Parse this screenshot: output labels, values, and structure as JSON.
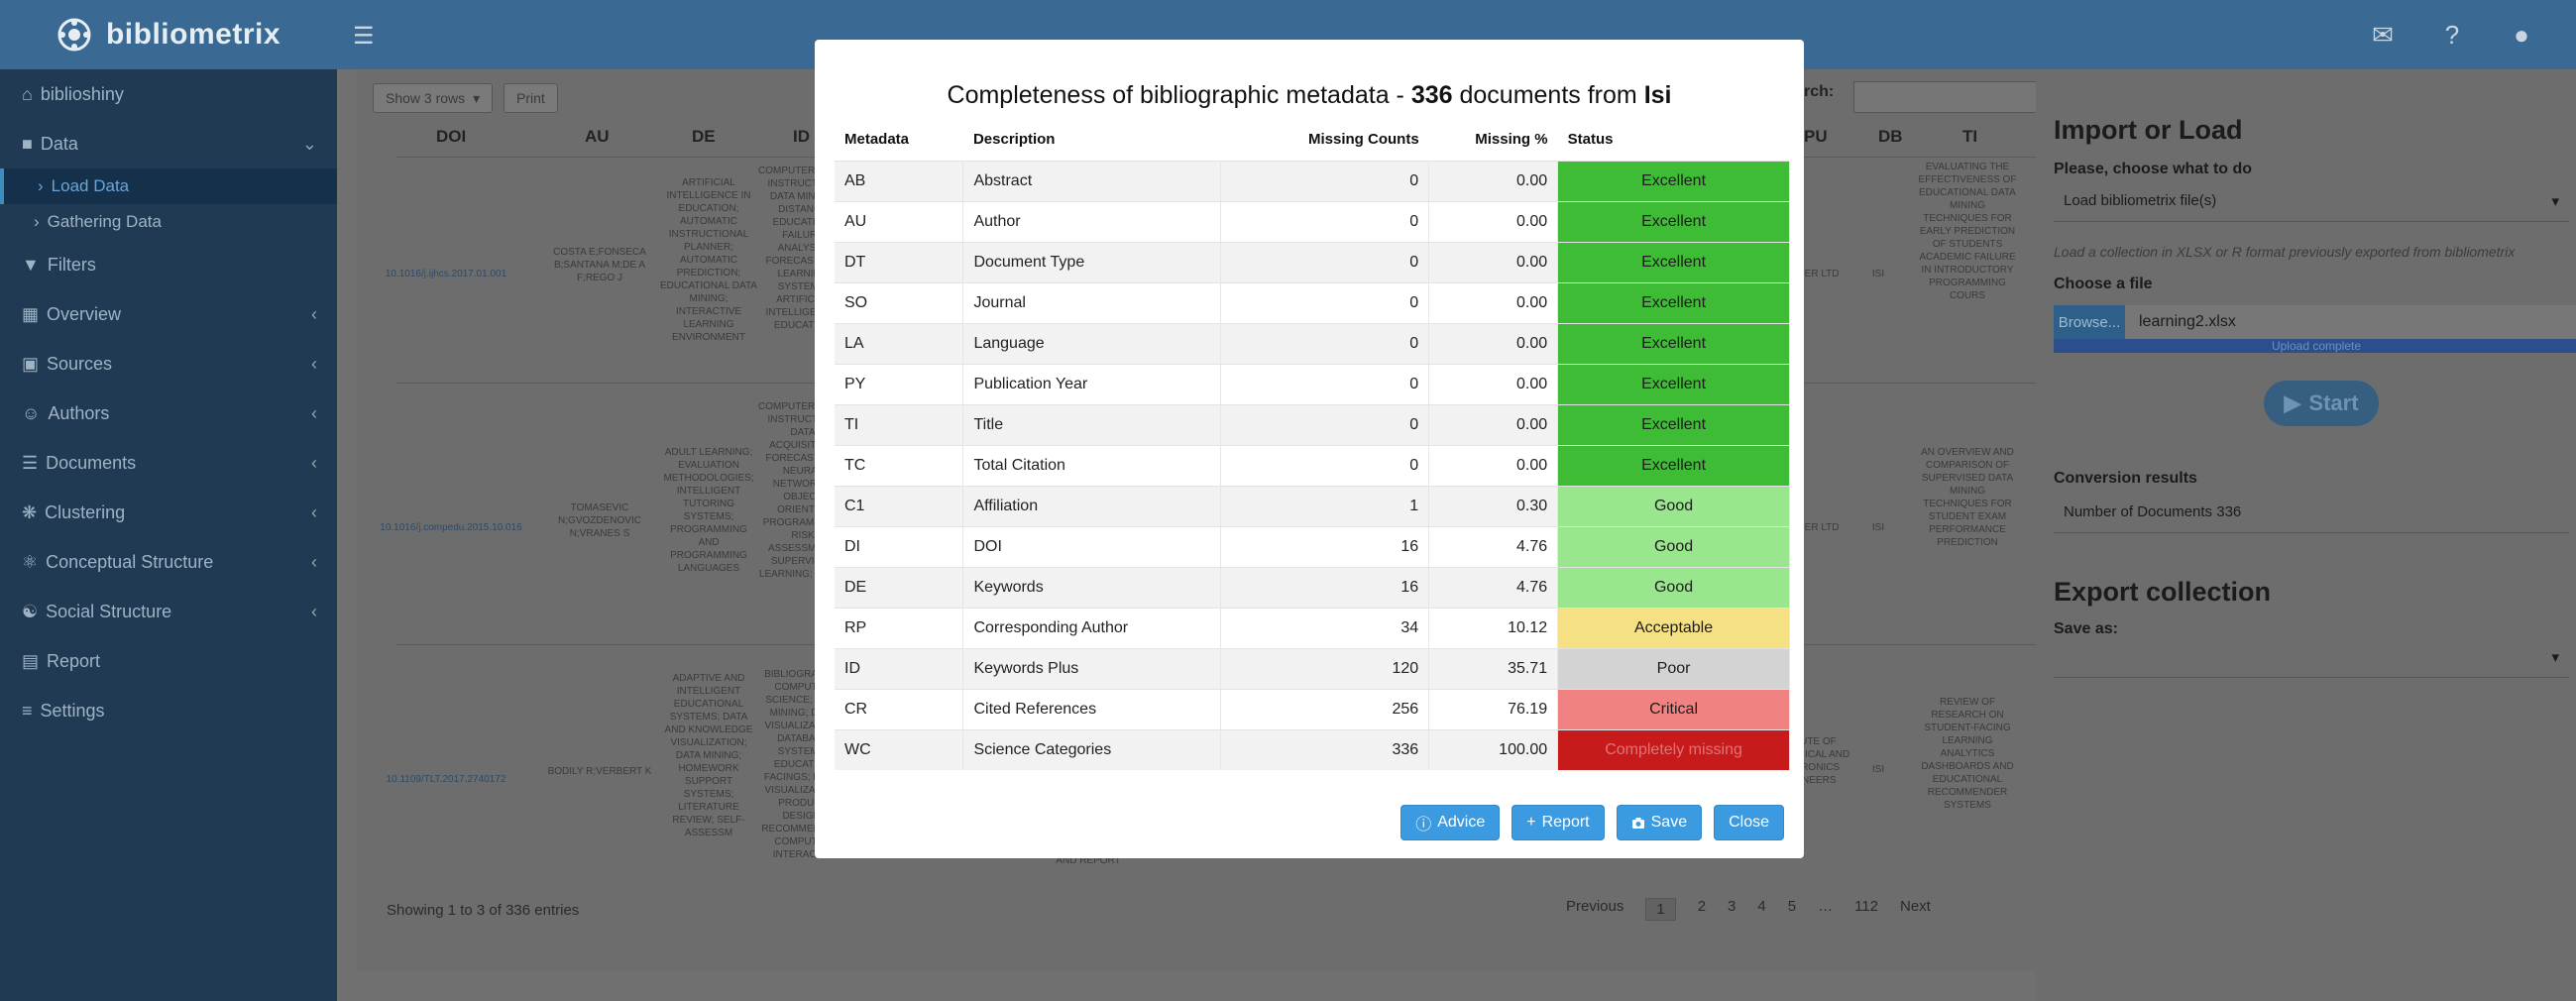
{
  "app": {
    "title": "bibliometrix"
  },
  "sidebar": {
    "items": [
      {
        "label": "biblioshiny",
        "icon": "home-icon"
      },
      {
        "label": "Data",
        "icon": "book-icon"
      },
      {
        "label": "Load Data",
        "icon": "chevron-right-icon"
      },
      {
        "label": "Gathering Data",
        "icon": "chevron-right-icon"
      },
      {
        "label": "Filters",
        "icon": "filter-icon"
      },
      {
        "label": "Overview",
        "icon": "grid-icon"
      },
      {
        "label": "Sources",
        "icon": "sources-icon"
      },
      {
        "label": "Authors",
        "icon": "user-icon"
      },
      {
        "label": "Documents",
        "icon": "documents-icon"
      },
      {
        "label": "Clustering",
        "icon": "clustering-icon"
      },
      {
        "label": "Conceptual Structure",
        "icon": "conceptual-icon"
      },
      {
        "label": "Social Structure",
        "icon": "social-icon"
      },
      {
        "label": "Report",
        "icon": "report-icon"
      },
      {
        "label": "Settings",
        "icon": "settings-icon"
      }
    ]
  },
  "background_table": {
    "show_rows": "Show 3 rows",
    "print": "Print",
    "search_label": "rch:",
    "headers": [
      "DOI",
      "AU",
      "DE",
      "ID",
      "PU",
      "DB",
      "TI"
    ],
    "rows": [
      {
        "doi": "10.1016/j.ijhcs.2017.01.001",
        "au": "COSTA E;FONSECA B;SANTANA M;DE A F;REGO J",
        "de": "ARTIFICIAL INTELLIGENCE IN EDUCATION; AUTOMATIC INSTRUCTIONAL PLANNER; AUTOMATIC PREDICTION; EDUCATIONAL DATA MINING; INTERACTIVE LEARNING ENVIRONMENT",
        "id": "COMPUTER AIDED INSTRUCTION; DATA MINING; DISTANCE EDUCATION; FAILURE ANALYSIS; FORECASTING; LEARNING SYSTEMS; ARTIFICIAL INTELLIGENCE; EDUCATION",
        "pu": "EVIER LTD",
        "db": "ISI",
        "ti": "EVALUATING THE EFFECTIVENESS OF EDUCATIONAL DATA MINING TECHNIQUES FOR EARLY PREDICTION OF STUDENTS ACADEMIC FAILURE IN INTRODUCTORY PROGRAMMING COURS"
      },
      {
        "doi": "10.1016/j.compedu.2015.10.016",
        "au": "TOMASEVIC N;GVOZDENOVIC N;VRANES S",
        "de": "ADULT LEARNING; EVALUATION METHODOLOGIES; INTELLIGENT TUTORING SYSTEMS; PROGRAMMING AND PROGRAMMING LANGUAGES",
        "id": "COMPUTER AIDED INSTRUCTION; DATA ACQUISITION; FORECASTING; NEURAL NETWORKS; OBJECT ORIENTED PROGRAMMING; RISK ASSESSMENT; SUPERVISED LEARNING; ADULT",
        "pu": "EVIER LTD",
        "db": "ISI",
        "ti": "AN OVERVIEW AND COMPARISON OF SUPERVISED DATA MINING TECHNIQUES FOR STUDENT EXAM PERFORMANCE PREDICTION"
      },
      {
        "doi": "10.1109/TLT.2017.2740172",
        "au": "BODILY R;VERBERT K",
        "de": "ADAPTIVE AND INTELLIGENT EDUCATIONAL SYSTEMS; DATA AND KNOWLEDGE VISUALIZATION; DATA MINING; HOMEWORK SUPPORT SYSTEMS; LITERATURE REVIEW; SELF-ASSESSM",
        "id": "BIBLIOGRAPHIC COMPUTER SCIENCE; DATA MINING; DATA VISUALIZATION; DATABASE SYSTEMS; EDUCATION FACINGS; FLOW VISUALIZATION; PRODUCT DESIGN; RECOMMENDER; COMPUTER INTERACTIO",
        "extra": "AND REPORT",
        "pu": "ITUTE OF ECTRICAL AND CTRONICS GINEERS",
        "db": "ISI",
        "ti": "REVIEW OF RESEARCH ON STUDENT-FACING LEARNING ANALYTICS DASHBOARDS AND EDUCATIONAL RECOMMENDER SYSTEMS"
      }
    ],
    "footer": "Showing 1 to 3 of 336 entries",
    "pager": [
      "Previous",
      "1",
      "2",
      "3",
      "4",
      "5",
      "…",
      "112",
      "Next"
    ]
  },
  "right_panel": {
    "import_title": "Import or Load",
    "choose_label": "Please, choose what to do",
    "choose_value": "Load bibliometrix file(s)",
    "note": "Load a collection in XLSX or R format previously exported from bibliometrix",
    "file_label": "Choose a file",
    "browse": "Browse...",
    "file_name": "learning2.xlsx",
    "upload_status": "Upload complete",
    "start": "Start",
    "conversion_label": "Conversion results",
    "doc_count": "Number of Documents  336",
    "export_title": "Export collection",
    "save_as_label": "Save as:"
  },
  "modal": {
    "title_prefix": "Completeness of bibliographic metadata - ",
    "title_count": "336",
    "title_mid": " documents from ",
    "title_source": "Isi",
    "columns": [
      "Metadata",
      "Description",
      "Missing Counts",
      "Missing %",
      "Status"
    ],
    "rows": [
      {
        "metadata": "AB",
        "description": "Abstract",
        "missing_counts": "0",
        "missing_pct": "0.00",
        "status": "Excellent"
      },
      {
        "metadata": "AU",
        "description": "Author",
        "missing_counts": "0",
        "missing_pct": "0.00",
        "status": "Excellent"
      },
      {
        "metadata": "DT",
        "description": "Document Type",
        "missing_counts": "0",
        "missing_pct": "0.00",
        "status": "Excellent"
      },
      {
        "metadata": "SO",
        "description": "Journal",
        "missing_counts": "0",
        "missing_pct": "0.00",
        "status": "Excellent"
      },
      {
        "metadata": "LA",
        "description": "Language",
        "missing_counts": "0",
        "missing_pct": "0.00",
        "status": "Excellent"
      },
      {
        "metadata": "PY",
        "description": "Publication Year",
        "missing_counts": "0",
        "missing_pct": "0.00",
        "status": "Excellent"
      },
      {
        "metadata": "TI",
        "description": "Title",
        "missing_counts": "0",
        "missing_pct": "0.00",
        "status": "Excellent"
      },
      {
        "metadata": "TC",
        "description": "Total Citation",
        "missing_counts": "0",
        "missing_pct": "0.00",
        "status": "Excellent"
      },
      {
        "metadata": "C1",
        "description": "Affiliation",
        "missing_counts": "1",
        "missing_pct": "0.30",
        "status": "Good"
      },
      {
        "metadata": "DI",
        "description": "DOI",
        "missing_counts": "16",
        "missing_pct": "4.76",
        "status": "Good"
      },
      {
        "metadata": "DE",
        "description": "Keywords",
        "missing_counts": "16",
        "missing_pct": "4.76",
        "status": "Good"
      },
      {
        "metadata": "RP",
        "description": "Corresponding Author",
        "missing_counts": "34",
        "missing_pct": "10.12",
        "status": "Acceptable"
      },
      {
        "metadata": "ID",
        "description": "Keywords Plus",
        "missing_counts": "120",
        "missing_pct": "35.71",
        "status": "Poor"
      },
      {
        "metadata": "CR",
        "description": "Cited References",
        "missing_counts": "256",
        "missing_pct": "76.19",
        "status": "Critical"
      },
      {
        "metadata": "WC",
        "description": "Science Categories",
        "missing_counts": "336",
        "missing_pct": "100.00",
        "status": "Completely missing"
      }
    ],
    "status_colors": {
      "Excellent": "#3ebc35",
      "Good": "#9ae68e",
      "Acceptable": "#f5e084",
      "Poor": "#d3d3d3",
      "Critical": "#f08282",
      "Completely missing": "#c71b1b"
    },
    "buttons": [
      {
        "label": "Advice",
        "icon": "info-icon"
      },
      {
        "label": "Report",
        "icon": "plus-icon"
      },
      {
        "label": "Save",
        "icon": "camera-icon"
      },
      {
        "label": "Close",
        "icon": ""
      }
    ]
  }
}
